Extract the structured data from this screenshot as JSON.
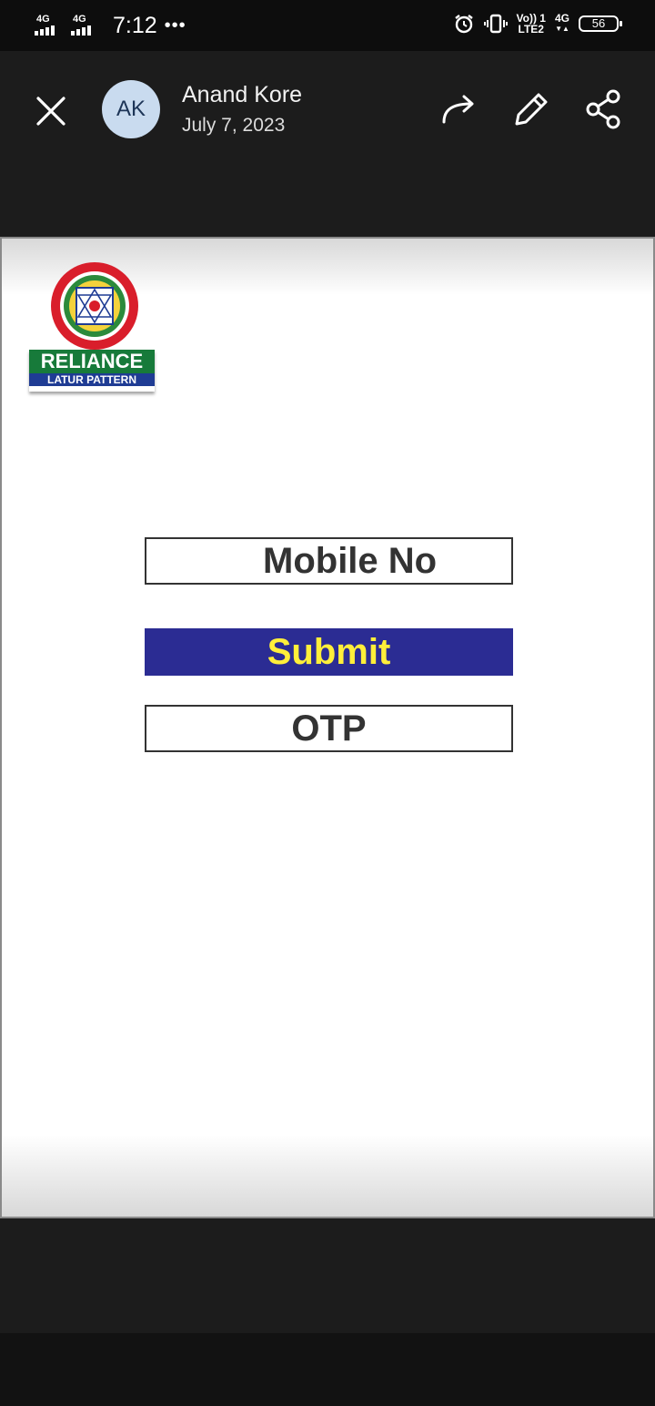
{
  "status_bar": {
    "sim1_label": "4G",
    "sim2_label": "4G",
    "time": "7:12",
    "more_dots": "•••",
    "volte_line1": "Vo)) 1",
    "volte_line2": "LTE2",
    "net_line1": "4G",
    "net_line2": "▼▲",
    "battery_level": "56"
  },
  "viewer": {
    "avatar_initials": "AK",
    "author_name": "Anand Kore",
    "date": "July 7, 2023"
  },
  "document": {
    "logo": {
      "brand_top": "RELIANCE",
      "brand_bottom": "LATUR PATTERN"
    },
    "mobile_label": "Mobile No",
    "submit_label": "Submit",
    "otp_label": "OTP"
  },
  "colors": {
    "submit_bg": "#2b2c93",
    "submit_text": "#ffef3a",
    "logo_green": "#177a3a",
    "logo_blue": "#1f3c94"
  }
}
